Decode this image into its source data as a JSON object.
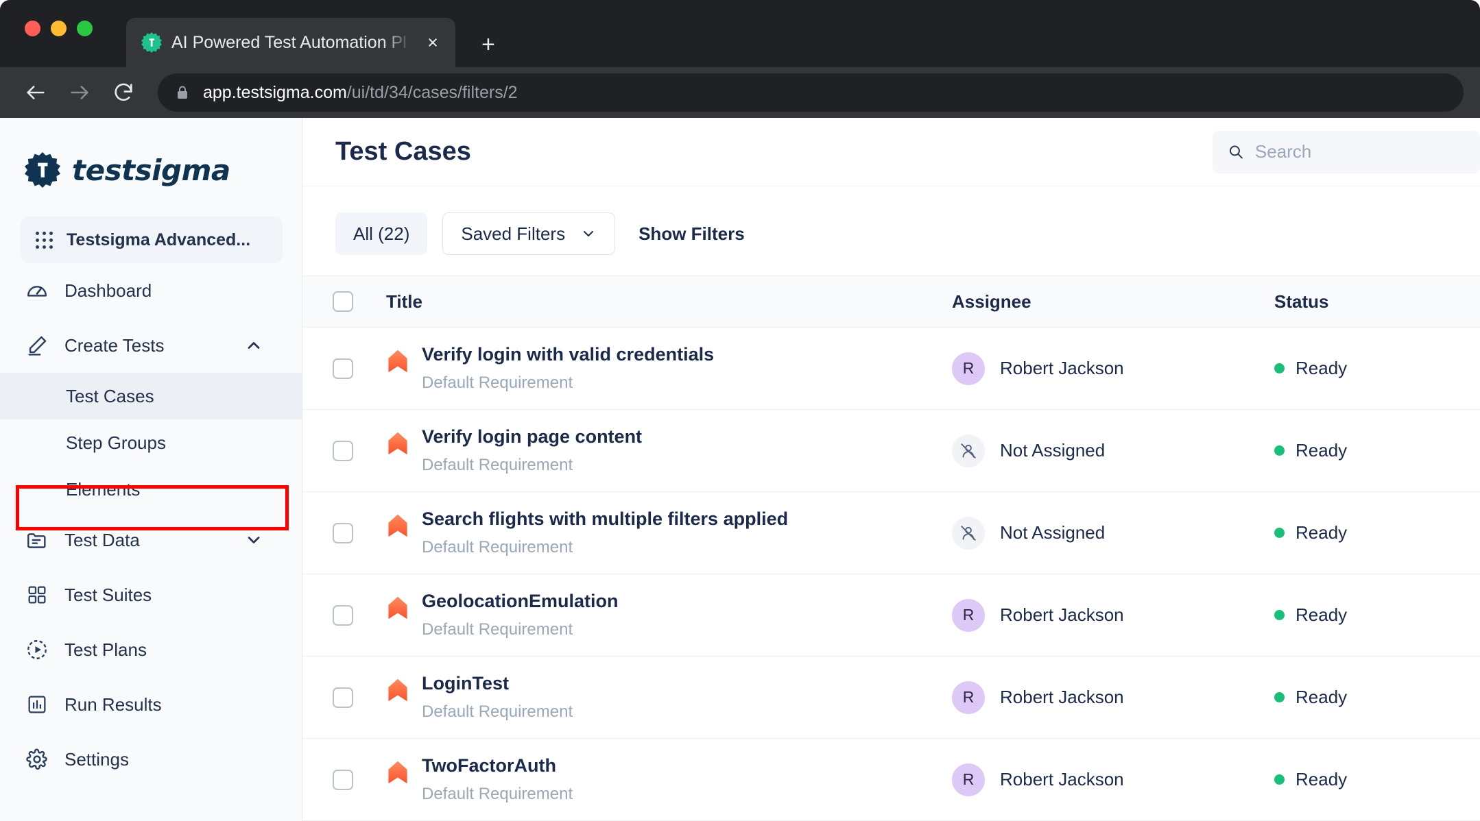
{
  "browser": {
    "tab": {
      "title": "AI Powered Test Automation Pl",
      "favicon": "testsigma-gear-icon",
      "close_label": "×"
    },
    "new_tab_label": "+",
    "url_domain": "app.testsigma.com",
    "url_path": "/ui/td/34/cases/filters/2",
    "back_icon": "arrow-left-icon",
    "forward_icon": "arrow-right-icon",
    "reload_icon": "reload-icon",
    "lock_icon": "lock-icon"
  },
  "sidebar": {
    "brand": "testsigma",
    "project": {
      "name": "Testsigma Advanced...",
      "icon": "app-grid-icon"
    },
    "items": [
      {
        "label": "Dashboard",
        "icon": "speedometer-icon",
        "expandable": false
      },
      {
        "label": "Create Tests",
        "icon": "pencil-icon",
        "expandable": true,
        "expanded": true,
        "chevron": "chevron-up-icon"
      },
      {
        "label": "Test Data",
        "icon": "folder-icon",
        "expandable": true,
        "expanded": false,
        "chevron": "chevron-down-icon"
      },
      {
        "label": "Test Suites",
        "icon": "grid-squares-icon",
        "expandable": false
      },
      {
        "label": "Test Plans",
        "icon": "play-circle-icon",
        "expandable": false
      },
      {
        "label": "Run Results",
        "icon": "bar-chart-icon",
        "expandable": false
      },
      {
        "label": "Settings",
        "icon": "gear-icon",
        "expandable": false
      }
    ],
    "sub_items": [
      {
        "label": "Test Cases",
        "active": true,
        "highlighted": true
      },
      {
        "label": "Step Groups",
        "active": false,
        "highlighted": false
      },
      {
        "label": "Elements",
        "active": false,
        "highlighted": false
      }
    ],
    "highlight_color": "#ff0000"
  },
  "main": {
    "page_title": "Test Cases",
    "search": {
      "placeholder": "Search",
      "value": "",
      "icon": "search-icon"
    },
    "filters": {
      "all_label": "All (22)",
      "saved_filters_label": "Saved Filters",
      "saved_filters_chevron": "chevron-down-icon",
      "show_filters_label": "Show Filters"
    },
    "table": {
      "columns": [
        "",
        "Title",
        "Assignee",
        "Status"
      ],
      "select_all_checkbox": false,
      "rows": [
        {
          "title": "Verify login with valid credentials",
          "requirement": "Default Requirement",
          "priority_icon": "priority-high-chevron-icon",
          "assignee": "Robert Jackson",
          "assignee_initial": "R",
          "assigned": true,
          "status": "Ready"
        },
        {
          "title": "Verify login page content",
          "requirement": "Default Requirement",
          "priority_icon": "priority-high-chevron-icon",
          "assignee": "Not Assigned",
          "assignee_initial": "",
          "assigned": false,
          "status": "Ready"
        },
        {
          "title": "Search flights with multiple filters applied",
          "requirement": "Default Requirement",
          "priority_icon": "priority-high-chevron-icon",
          "assignee": "Not Assigned",
          "assignee_initial": "",
          "assigned": false,
          "status": "Ready"
        },
        {
          "title": "GeolocationEmulation",
          "requirement": "Default Requirement",
          "priority_icon": "priority-high-chevron-icon",
          "assignee": "Robert Jackson",
          "assignee_initial": "R",
          "assigned": true,
          "status": "Ready"
        },
        {
          "title": "LoginTest",
          "requirement": "Default Requirement",
          "priority_icon": "priority-high-chevron-icon",
          "assignee": "Robert Jackson",
          "assignee_initial": "R",
          "assigned": true,
          "status": "Ready"
        },
        {
          "title": "TwoFactorAuth",
          "requirement": "Default Requirement",
          "priority_icon": "priority-high-chevron-icon",
          "assignee": "Robert Jackson",
          "assignee_initial": "R",
          "assigned": true,
          "status": "Ready"
        }
      ]
    }
  },
  "colors": {
    "brand_navy": "#0f3350",
    "priority_orange": "#fa6c46",
    "status_green": "#18c07a",
    "avatar_purple": "#ddc8f7",
    "highlight_red": "#ff0000"
  }
}
